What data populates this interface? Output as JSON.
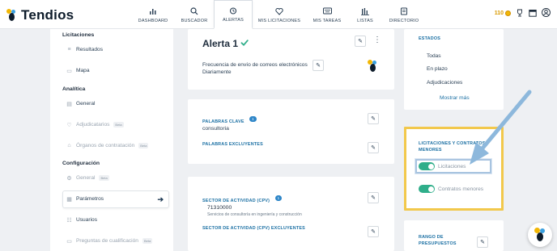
{
  "app": {
    "name": "Tendios"
  },
  "nav": [
    {
      "label": "DASHBOARD",
      "icon": "bar-chart-icon"
    },
    {
      "label": "BUSCADOR",
      "icon": "search-icon"
    },
    {
      "label": "ALERTAS",
      "icon": "alarm-clock-icon",
      "active": true
    },
    {
      "label": "MIS LICITACIONES",
      "icon": "heart-icon"
    },
    {
      "label": "MIS TAREAS",
      "icon": "keyboard-icon"
    },
    {
      "label": "LISTAS",
      "icon": "list-bars-icon"
    },
    {
      "label": "DIRECTORIO",
      "icon": "directory-icon"
    }
  ],
  "top_right": {
    "coins": "110"
  },
  "sidebar": {
    "licitaciones_title": "Licitaciones",
    "resultados": "Resultados",
    "mapa": "Mapa",
    "analitica_title": "Analítica",
    "general": "General",
    "adjudicatarios": "Adjudicatarios",
    "organos": "Órganos de contratación",
    "beta": "Beta",
    "configuracion_title": "Configuración",
    "config_general": "General",
    "parametros": "Parámetros",
    "usuarios": "Usuarios",
    "preguntas": "Preguntas de cualificación"
  },
  "alert": {
    "title": "Alerta 1",
    "frequency_label": "Frecuencia de envío de correos electrónicos",
    "frequency_value": "Diariamente"
  },
  "keywords": {
    "title": "PALABRAS CLAVE",
    "count": "1",
    "value": "consultoria",
    "excluded_title": "PALABRAS EXCLUYENTES"
  },
  "sector": {
    "title": "SECTOR DE ACTIVIDAD (CPV)",
    "count": "1",
    "code": "71310000",
    "description": "Servicios de consultoría en ingeniería y construcción",
    "excluded_title": "SECTOR DE ACTIVIDAD (CPV) EXCLUYENTES"
  },
  "estados": {
    "title": "ESTADOS",
    "items": [
      "Todas",
      "En plazo",
      "Adjudicaciones"
    ],
    "more": "Mostrar más"
  },
  "tipos": {
    "title_line1": "LICITACIONES Y CONTRATOS",
    "title_line2": "MENORES",
    "licitaciones": "Licitaciones",
    "contratos": "Contratos menores"
  },
  "presupuestos": {
    "title_line1": "RANGO DE",
    "title_line2": "PRESUPUESTOS"
  },
  "colors": {
    "highlight": "#f2c84b",
    "toggle_on": "#2fae8a",
    "arrow": "#8db8dc",
    "check": "#2fae8a"
  }
}
